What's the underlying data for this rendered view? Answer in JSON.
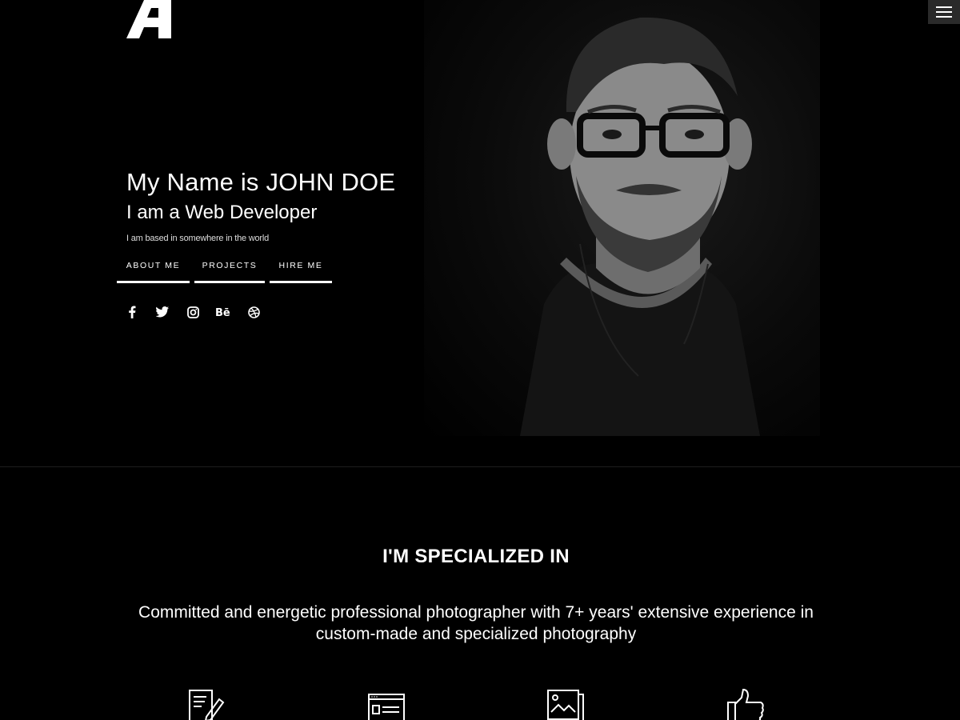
{
  "header": {
    "logo_icon": "logo-a-icon",
    "menu_icon": "hamburger-menu-icon"
  },
  "hero": {
    "name": "My Name is JOHN DOE",
    "role": "I am a Web Developer",
    "location": "I am based in somewhere in the world",
    "buttons": [
      {
        "label": "ABOUT ME"
      },
      {
        "label": "PROJECTS"
      },
      {
        "label": "HIRE ME"
      }
    ],
    "social": [
      "facebook-icon",
      "twitter-icon",
      "instagram-icon",
      "behance-icon",
      "dribbble-icon"
    ]
  },
  "specialized": {
    "title": "I'M SPECIALIZED IN",
    "description": "Committed and energetic professional photographer with 7+ years' extensive experience in custom-made and specialized photography",
    "icons": [
      "edit-document-icon",
      "browser-window-icon",
      "image-gallery-icon",
      "thumbs-up-icon"
    ]
  },
  "colors": {
    "background": "#000000",
    "text": "#ffffff",
    "menu_bg": "#2a2a2a"
  }
}
